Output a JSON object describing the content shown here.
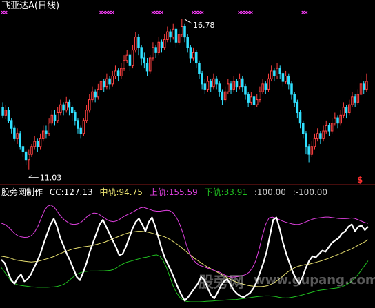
{
  "panel1": {
    "title": "飞亚达A(日线)",
    "high_label": "16.78",
    "low_label": "11.03",
    "dollar_marker": "$"
  },
  "panel2": {
    "indicator_name": "股旁网制作",
    "cc_label": "CC:127.13",
    "mid_label": "中轨:94.75",
    "upper_label": "上轨:155.59",
    "lower_label": "下轨:33.91",
    "ref_high": ":100.00",
    "ref_low": ":-100.00"
  },
  "watermark": {
    "cn": "股旁网",
    "url": "www.gupang.com"
  },
  "colors": {
    "up": "#ff4040",
    "down": "#30e0ff",
    "cc": "#ffffff",
    "mid": "#e8e070",
    "upper": "#e040e0",
    "lower": "#20c020",
    "marker": "#ff40ff"
  },
  "chart_data": [
    {
      "type": "candlestick",
      "title": "飞亚达A(日线)",
      "ylim": [
        10.6,
        17.2
      ],
      "annotations": [
        {
          "text": "16.78",
          "value": 16.78,
          "index": 63
        },
        {
          "text": "11.03",
          "value": 11.03,
          "index": 9
        }
      ],
      "candles": [
        [
          13.4,
          13.1,
          13.6,
          13.0
        ],
        [
          13.1,
          13.3,
          13.5,
          12.95
        ],
        [
          13.3,
          12.9,
          13.4,
          12.8
        ],
        [
          12.9,
          12.6,
          13.0,
          12.4
        ],
        [
          12.6,
          12.2,
          12.7,
          12.1
        ],
        [
          12.2,
          12.4,
          12.6,
          12.0
        ],
        [
          12.4,
          11.9,
          12.5,
          11.8
        ],
        [
          11.9,
          11.7,
          12.0,
          11.5
        ],
        [
          11.7,
          11.4,
          11.8,
          11.2
        ],
        [
          11.4,
          11.6,
          11.8,
          11.03
        ],
        [
          11.6,
          11.9,
          12.0,
          11.5
        ],
        [
          11.9,
          12.1,
          12.3,
          11.8
        ],
        [
          12.1,
          11.9,
          12.2,
          11.7
        ],
        [
          11.9,
          12.2,
          12.4,
          11.8
        ],
        [
          12.2,
          12.5,
          12.7,
          12.1
        ],
        [
          12.5,
          12.4,
          12.7,
          12.2
        ],
        [
          12.4,
          12.8,
          13.0,
          12.3
        ],
        [
          12.8,
          13.1,
          13.3,
          12.7
        ],
        [
          13.1,
          12.9,
          13.3,
          12.7
        ],
        [
          12.9,
          13.2,
          13.4,
          12.8
        ],
        [
          13.2,
          13.5,
          13.7,
          13.1
        ],
        [
          13.5,
          13.3,
          13.6,
          13.1
        ],
        [
          13.3,
          13.6,
          13.8,
          13.2
        ],
        [
          13.6,
          13.4,
          13.7,
          13.1
        ],
        [
          13.4,
          13.2,
          13.5,
          12.9
        ],
        [
          13.2,
          12.9,
          13.3,
          12.7
        ],
        [
          12.9,
          12.6,
          13.0,
          12.4
        ],
        [
          12.6,
          12.4,
          12.7,
          12.2
        ],
        [
          12.4,
          12.9,
          13.0,
          12.3
        ],
        [
          12.9,
          13.3,
          13.5,
          12.8
        ],
        [
          13.3,
          13.7,
          13.9,
          13.2
        ],
        [
          13.7,
          14.0,
          14.2,
          13.6
        ],
        [
          14.0,
          13.8,
          14.1,
          13.6
        ],
        [
          13.8,
          14.1,
          14.3,
          13.7
        ],
        [
          14.1,
          14.4,
          14.6,
          14.0
        ],
        [
          14.4,
          14.2,
          14.5,
          14.0
        ],
        [
          14.2,
          14.5,
          14.7,
          14.1
        ],
        [
          14.5,
          14.3,
          14.6,
          14.1
        ],
        [
          14.3,
          14.6,
          14.8,
          14.2
        ],
        [
          14.6,
          14.8,
          15.0,
          14.5
        ],
        [
          14.8,
          14.6,
          14.9,
          14.4
        ],
        [
          14.6,
          14.9,
          15.1,
          14.5
        ],
        [
          14.9,
          15.2,
          15.4,
          14.8
        ],
        [
          15.2,
          15.4,
          15.6,
          15.1
        ],
        [
          15.4,
          15.0,
          15.5,
          14.8
        ],
        [
          15.0,
          15.6,
          15.8,
          14.9
        ],
        [
          15.6,
          16.1,
          16.3,
          15.5
        ],
        [
          16.1,
          15.7,
          16.2,
          15.4
        ],
        [
          15.7,
          15.3,
          15.8,
          15.0
        ],
        [
          15.3,
          15.1,
          15.5,
          14.9
        ],
        [
          15.1,
          14.8,
          15.3,
          14.6
        ],
        [
          14.8,
          15.3,
          15.4,
          14.7
        ],
        [
          15.3,
          15.7,
          15.9,
          15.2
        ],
        [
          15.7,
          15.5,
          15.8,
          15.3
        ],
        [
          15.5,
          15.9,
          16.1,
          15.4
        ],
        [
          15.9,
          15.7,
          16.0,
          15.5
        ],
        [
          15.7,
          16.0,
          16.2,
          15.6
        ],
        [
          16.0,
          16.3,
          16.5,
          15.9
        ],
        [
          16.3,
          16.1,
          16.4,
          15.9
        ],
        [
          16.1,
          16.4,
          16.6,
          16.0
        ],
        [
          16.4,
          15.9,
          16.5,
          15.7
        ],
        [
          15.9,
          16.2,
          16.4,
          15.8
        ],
        [
          16.2,
          16.5,
          16.78,
          16.1
        ],
        [
          16.5,
          16.1,
          16.6,
          15.9
        ],
        [
          16.1,
          15.7,
          16.2,
          15.5
        ],
        [
          15.7,
          15.3,
          15.8,
          15.1
        ],
        [
          15.3,
          15.5,
          15.7,
          15.2
        ],
        [
          15.5,
          15.1,
          15.6,
          14.9
        ],
        [
          15.1,
          14.7,
          15.2,
          14.5
        ],
        [
          14.7,
          14.3,
          14.8,
          14.1
        ],
        [
          14.3,
          14.1,
          14.5,
          13.9
        ],
        [
          14.1,
          14.4,
          14.6,
          14.0
        ],
        [
          14.4,
          14.2,
          14.5,
          14.0
        ],
        [
          14.2,
          14.5,
          14.7,
          14.1
        ],
        [
          14.5,
          14.3,
          14.6,
          14.1
        ],
        [
          14.3,
          14.0,
          14.4,
          13.8
        ],
        [
          14.0,
          13.7,
          14.1,
          13.5
        ],
        [
          13.7,
          14.0,
          14.2,
          13.6
        ],
        [
          14.0,
          14.3,
          14.5,
          13.9
        ],
        [
          14.3,
          14.1,
          14.4,
          13.9
        ],
        [
          14.1,
          14.4,
          14.6,
          14.0
        ],
        [
          14.4,
          14.2,
          14.5,
          14.0
        ],
        [
          14.2,
          14.5,
          14.7,
          14.1
        ],
        [
          14.5,
          14.2,
          14.6,
          14.0
        ],
        [
          14.2,
          13.9,
          14.3,
          13.7
        ],
        [
          13.9,
          13.6,
          14.0,
          13.4
        ],
        [
          13.6,
          13.8,
          14.0,
          13.5
        ],
        [
          13.8,
          13.5,
          13.9,
          13.3
        ],
        [
          13.5,
          13.7,
          13.9,
          13.4
        ],
        [
          13.7,
          14.0,
          14.2,
          13.6
        ],
        [
          14.0,
          14.3,
          14.5,
          13.9
        ],
        [
          14.3,
          14.1,
          14.4,
          13.9
        ],
        [
          14.1,
          14.5,
          14.7,
          14.0
        ],
        [
          14.5,
          14.8,
          15.0,
          14.4
        ],
        [
          14.8,
          14.6,
          14.9,
          14.4
        ],
        [
          14.6,
          14.9,
          15.1,
          14.5
        ],
        [
          14.9,
          14.7,
          15.0,
          14.5
        ],
        [
          14.7,
          14.4,
          14.8,
          14.2
        ],
        [
          14.4,
          14.6,
          14.8,
          14.3
        ],
        [
          14.6,
          14.3,
          14.7,
          14.1
        ],
        [
          14.3,
          13.9,
          14.4,
          13.7
        ],
        [
          13.9,
          13.6,
          14.0,
          13.4
        ],
        [
          13.6,
          13.2,
          13.7,
          13.0
        ],
        [
          13.2,
          12.8,
          13.3,
          12.6
        ],
        [
          12.8,
          12.4,
          12.9,
          12.2
        ],
        [
          12.4,
          11.9,
          12.5,
          11.6
        ],
        [
          11.9,
          11.6,
          12.0,
          11.3
        ],
        [
          11.6,
          11.9,
          12.1,
          11.5
        ],
        [
          11.9,
          12.2,
          12.4,
          11.8
        ],
        [
          12.2,
          12.4,
          12.6,
          12.1
        ],
        [
          12.4,
          12.2,
          12.5,
          12.0
        ],
        [
          12.2,
          12.5,
          12.7,
          12.1
        ],
        [
          12.5,
          12.7,
          12.9,
          12.4
        ],
        [
          12.7,
          12.5,
          12.8,
          12.3
        ],
        [
          12.5,
          12.8,
          13.0,
          12.4
        ],
        [
          12.8,
          13.0,
          13.2,
          12.7
        ],
        [
          13.0,
          12.8,
          13.1,
          12.6
        ],
        [
          12.8,
          13.1,
          13.3,
          12.7
        ],
        [
          13.1,
          13.4,
          13.6,
          13.0
        ],
        [
          13.4,
          13.2,
          13.5,
          13.0
        ],
        [
          13.2,
          13.5,
          13.7,
          13.1
        ],
        [
          13.5,
          13.8,
          14.0,
          13.4
        ],
        [
          13.8,
          13.6,
          13.9,
          13.4
        ],
        [
          13.6,
          13.9,
          14.1,
          13.5
        ],
        [
          13.9,
          14.3,
          14.6,
          13.8
        ],
        [
          14.3,
          14.1,
          14.4,
          13.9
        ],
        [
          14.1,
          14.4,
          14.7,
          14.0
        ]
      ]
    },
    {
      "type": "line",
      "title": "股旁网制作",
      "ylim": [
        -190,
        270
      ],
      "series": [
        {
          "name": "CC",
          "values": [
            -5,
            -20,
            -60,
            -95,
            -110,
            -85,
            -70,
            -100,
            -90,
            -70,
            -40,
            -10,
            25,
            70,
            110,
            150,
            175,
            140,
            90,
            55,
            20,
            -10,
            -45,
            -80,
            -95,
            -60,
            -20,
            30,
            70,
            110,
            150,
            170,
            140,
            110,
            80,
            50,
            15,
            20,
            50,
            90,
            130,
            160,
            175,
            150,
            120,
            160,
            180,
            140,
            90,
            40,
            0,
            -30,
            -60,
            -95,
            -130,
            -160,
            -185,
            -170,
            -150,
            -130,
            -110,
            -80,
            -95,
            -130,
            -160,
            -175,
            -150,
            -120,
            -100,
            -90,
            -115,
            -140,
            -155,
            -165,
            -170,
            -160,
            -150,
            -130,
            -100,
            -60,
            -20,
            30,
            100,
            170,
            180,
            130,
            70,
            20,
            -20,
            -60,
            -90,
            -110,
            -80,
            -40,
            -10,
            10,
            5,
            20,
            35,
            30,
            50,
            70,
            80,
            90,
            110,
            120,
            140,
            150,
            120,
            140,
            145,
            125,
            140
          ]
        },
        {
          "name": "中轨",
          "values": [
            10,
            8,
            5,
            0,
            -5,
            -8,
            -10,
            -12,
            -14,
            -15,
            -14,
            -12,
            -8,
            -4,
            0,
            5,
            10,
            18,
            24,
            30,
            35,
            40,
            44,
            47,
            50,
            52,
            54,
            56,
            60,
            64,
            68,
            72,
            78,
            84,
            90,
            96,
            102,
            108,
            112,
            116,
            118,
            120,
            120,
            118,
            116,
            112,
            108,
            104,
            100,
            95,
            88,
            80,
            70,
            60,
            48,
            36,
            24,
            12,
            0,
            -10,
            -20,
            -30,
            -38,
            -46,
            -54,
            -62,
            -70,
            -78,
            -86,
            -94,
            -100,
            -106,
            -110,
            -114,
            -118,
            -120,
            -122,
            -123,
            -123,
            -121,
            -118,
            -112,
            -104,
            -94,
            -82,
            -70,
            -58,
            -48,
            -40,
            -34,
            -30,
            -27,
            -25,
            -22,
            -18,
            -14,
            -10,
            -5,
            0,
            6,
            12,
            18,
            24,
            30,
            36,
            42,
            50,
            58,
            66,
            74,
            82
          ]
        },
        {
          "name": "上轨",
          "values": [
            155,
            150,
            140,
            125,
            110,
            100,
            95,
            93,
            94,
            100,
            115,
            140,
            175,
            210,
            230,
            235,
            225,
            205,
            185,
            170,
            160,
            152,
            150,
            152,
            158,
            170,
            185,
            195,
            200,
            198,
            190,
            180,
            170,
            164,
            162,
            166,
            174,
            184,
            192,
            198,
            206,
            214,
            222,
            225,
            220,
            215,
            210,
            208,
            208,
            210,
            212,
            210,
            200,
            180,
            150,
            110,
            60,
            20,
            -5,
            -20,
            -30,
            -35,
            -40,
            -45,
            -50,
            -55,
            -60,
            -68,
            -75,
            -80,
            -82,
            -80,
            -78,
            -75,
            -70,
            -60,
            -40,
            -10,
            40,
            100,
            150,
            178,
            182,
            178,
            172,
            165,
            160,
            156,
            152,
            150,
            150,
            154,
            160,
            166,
            172,
            176,
            178,
            180,
            182,
            182,
            180,
            178,
            176,
            175,
            175,
            176,
            178,
            176,
            170,
            164,
            158,
            155
          ]
        },
        {
          "name": "下轨",
          "values": [
            -40,
            -60,
            -80,
            -100,
            -110,
            -115,
            -118,
            -120,
            -122,
            -124,
            -125,
            -126,
            -126,
            -126,
            -126,
            -125,
            -124,
            -122,
            -118,
            -112,
            -102,
            -90,
            -78,
            -68,
            -62,
            -58,
            -56,
            -55,
            -55,
            -55,
            -54,
            -54,
            -53,
            -52,
            -48,
            -40,
            -30,
            -22,
            -16,
            -12,
            -8,
            -4,
            0,
            4,
            6,
            10,
            14,
            16,
            10,
            -10,
            -40,
            -80,
            -120,
            -150,
            -170,
            -182,
            -188,
            -190,
            -190,
            -190,
            -190,
            -189,
            -188,
            -187,
            -186,
            -185,
            -184,
            -183,
            -182,
            -181,
            -180,
            -180,
            -178,
            -176,
            -174,
            -172,
            -170,
            -168,
            -166,
            -165,
            -164,
            -164,
            -165,
            -167,
            -170,
            -172,
            -173,
            -172,
            -170,
            -167,
            -164,
            -160,
            -156,
            -152,
            -148,
            -144,
            -140,
            -138,
            -136,
            -134,
            -132,
            -130,
            -128,
            -124,
            -118,
            -110,
            -100,
            -85,
            -70,
            -50,
            -30,
            -10
          ]
        },
        {
          "name": "100",
          "values": [
            100
          ]
        },
        {
          "name": "-100",
          "values": [
            -100
          ]
        }
      ]
    }
  ]
}
